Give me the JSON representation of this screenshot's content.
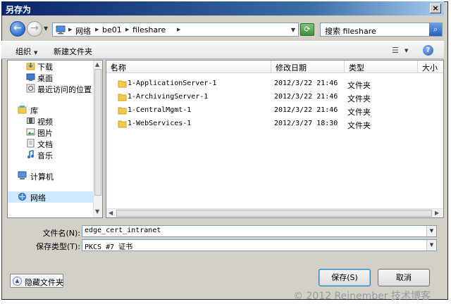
{
  "window": {
    "title": "另存为"
  },
  "navigation": {
    "breadcrumbs": [
      "网络",
      "be01",
      "fileshare"
    ],
    "search_label": "搜索 fileshare"
  },
  "toolbar": {
    "organize": "组织",
    "new_folder": "新建文件夹"
  },
  "sidebar": {
    "items": [
      {
        "label": "下载",
        "icon": "download-folder-icon",
        "group": "favorites"
      },
      {
        "label": "桌面",
        "icon": "desktop-icon",
        "group": "favorites"
      },
      {
        "label": "最近访问的位置",
        "icon": "recent-places-icon",
        "group": "favorites"
      },
      {
        "label": "库",
        "icon": "library-icon",
        "group": "libraries"
      },
      {
        "label": "视频",
        "icon": "video-icon",
        "group": "libraries"
      },
      {
        "label": "图片",
        "icon": "pictures-icon",
        "group": "libraries"
      },
      {
        "label": "文档",
        "icon": "documents-icon",
        "group": "libraries"
      },
      {
        "label": "音乐",
        "icon": "music-icon",
        "group": "libraries"
      },
      {
        "label": "计算机",
        "icon": "computer-icon",
        "group": "computer"
      },
      {
        "label": "网络",
        "icon": "network-icon",
        "group": "network",
        "selected": true
      }
    ]
  },
  "files": {
    "columns": {
      "name": "名称",
      "modified": "修改日期",
      "type": "类型",
      "size": "大小"
    },
    "rows": [
      {
        "name": "1-ApplicationServer-1",
        "modified": "2012/3/22 21:46",
        "type": "文件夹"
      },
      {
        "name": "1-ArchivingServer-1",
        "modified": "2012/3/22 21:46",
        "type": "文件夹"
      },
      {
        "name": "1-CentralMgmt-1",
        "modified": "2012/3/22 21:46",
        "type": "文件夹"
      },
      {
        "name": "1-WebServices-1",
        "modified": "2012/3/27 18:30",
        "type": "文件夹"
      }
    ]
  },
  "form": {
    "filename_label": "文件名(N):",
    "filename_value": "edge_cert_intranet",
    "filetype_label": "保存类型(T):",
    "filetype_value": "PKCS #7 证书"
  },
  "footer": {
    "hide_folders": "隐藏文件夹",
    "save": "保存(S)",
    "cancel": "取消",
    "watermark": "© 2012 Reinember 技术博客"
  },
  "colors": {
    "selection": "#cde8ff",
    "folder": "#f2c94c",
    "title_bar": "#0a246a"
  }
}
